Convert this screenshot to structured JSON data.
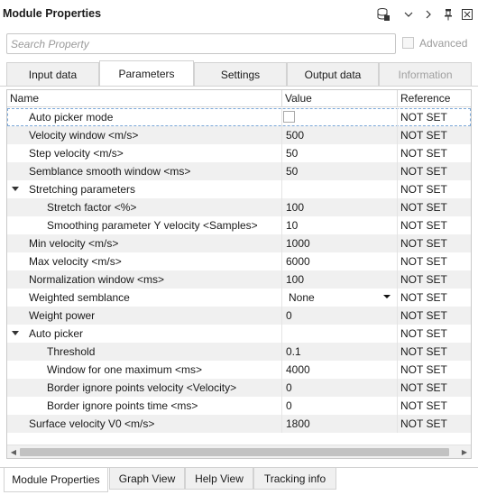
{
  "window": {
    "title": "Module Properties",
    "controls": {
      "chevron_down": "∨",
      "chevron_right": ">",
      "pin": "📌",
      "close": "⊠"
    }
  },
  "search": {
    "placeholder": "Search Property",
    "value": "",
    "advanced_label": "Advanced",
    "advanced_checked": false
  },
  "tabs": [
    {
      "label": "Input data",
      "active": false,
      "disabled": false
    },
    {
      "label": "Parameters",
      "active": true,
      "disabled": false
    },
    {
      "label": "Settings",
      "active": false,
      "disabled": false
    },
    {
      "label": "Output data",
      "active": false,
      "disabled": false
    },
    {
      "label": "Information",
      "active": false,
      "disabled": true
    }
  ],
  "grid": {
    "columns": {
      "name": "Name",
      "value": "Value",
      "reference": "Reference"
    },
    "rows": [
      {
        "name": "Auto picker mode",
        "value": "",
        "checkbox": true,
        "reference": "NOT SET",
        "indent": 1
      },
      {
        "name": "Velocity window <m/s>",
        "value": "500",
        "reference": "NOT SET",
        "indent": 1
      },
      {
        "name": "Step velocity <m/s>",
        "value": "50",
        "reference": "NOT SET",
        "indent": 1
      },
      {
        "name": "Semblance smooth window <ms>",
        "value": "50",
        "reference": "NOT SET",
        "indent": 1
      },
      {
        "name": "Stretching parameters",
        "value": "",
        "group": true,
        "reference": "NOT SET",
        "indent": 1
      },
      {
        "name": "Stretch factor <%>",
        "value": "100",
        "reference": "NOT SET",
        "indent": 2
      },
      {
        "name": "Smoothing parameter Y velocity <Samples>",
        "value": "10",
        "reference": "NOT SET",
        "indent": 2
      },
      {
        "name": "Min velocity <m/s>",
        "value": "1000",
        "reference": "NOT SET",
        "indent": 1
      },
      {
        "name": "Max velocity <m/s>",
        "value": "6000",
        "reference": "NOT SET",
        "indent": 1
      },
      {
        "name": "Normalization window <ms>",
        "value": "100",
        "reference": "NOT SET",
        "indent": 1
      },
      {
        "name": "Weighted semblance",
        "value": "None",
        "dropdown": true,
        "reference": "NOT SET",
        "indent": 1
      },
      {
        "name": "Weight power",
        "value": "0",
        "reference": "NOT SET",
        "indent": 1
      },
      {
        "name": "Auto picker",
        "value": "",
        "group": true,
        "reference": "NOT SET",
        "indent": 1
      },
      {
        "name": "Threshold",
        "value": "0.1",
        "reference": "NOT SET",
        "indent": 2
      },
      {
        "name": "Window for one maximum <ms>",
        "value": "4000",
        "reference": "NOT SET",
        "indent": 2
      },
      {
        "name": "Border ignore points velocity <Velocity>",
        "value": "0",
        "reference": "NOT SET",
        "indent": 2
      },
      {
        "name": "Border ignore points time <ms>",
        "value": "0",
        "reference": "NOT SET",
        "indent": 2
      },
      {
        "name": "Surface velocity V0 <m/s>",
        "value": "1800",
        "reference": "NOT SET",
        "indent": 1
      }
    ]
  },
  "bottom_tabs": [
    {
      "label": "Module Properties",
      "active": true
    },
    {
      "label": "Graph View",
      "active": false
    },
    {
      "label": "Help View",
      "active": false
    },
    {
      "label": "Tracking info",
      "active": false
    }
  ]
}
